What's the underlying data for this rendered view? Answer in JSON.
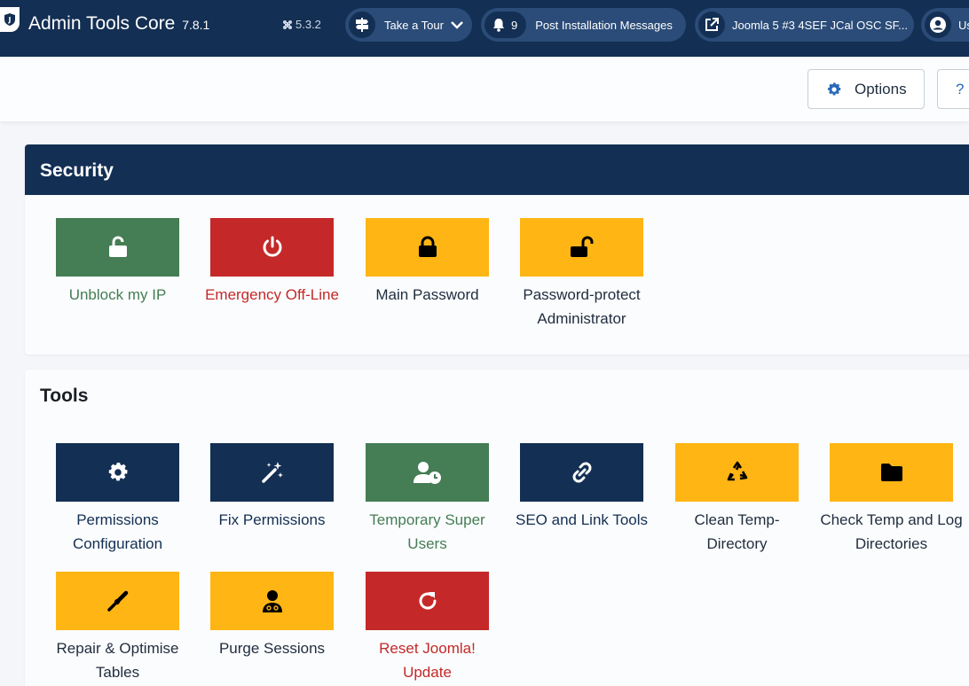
{
  "header": {
    "app_title": "Admin Tools Core",
    "app_version": "7.8.1",
    "joomla_version": "5.3.2",
    "tour_label": "Take a Tour",
    "messages_count": "9",
    "messages_label": "Post Installation Messages",
    "site_label": "Joomla 5 #3 4SEF JCal OSC SF...",
    "user_label": "User Menu"
  },
  "toolbar": {
    "options_label": "Options",
    "help_label": "?"
  },
  "sections": {
    "security": {
      "title": "Security",
      "items": [
        {
          "label": "Unblock my IP",
          "icon": "unlock-icon",
          "color": "#457d54"
        },
        {
          "label": "Emergency Off-Line",
          "icon": "power-icon",
          "color": "#c52828"
        },
        {
          "label": "Main Password",
          "icon": "lock-icon",
          "color": "#ffb514"
        },
        {
          "label": "Password-protect Administrator",
          "icon": "lock-open-icon",
          "color": "#ffb514"
        }
      ]
    },
    "tools": {
      "title": "Tools",
      "items": [
        {
          "label": "Permissions Configuration",
          "icon": "gear-icon",
          "color": "#132f53"
        },
        {
          "label": "Fix Permissions",
          "icon": "magic-wand-icon",
          "color": "#132f53"
        },
        {
          "label": "Temporary Super Users",
          "icon": "user-clock-icon",
          "color": "#457d54"
        },
        {
          "label": "SEO and Link Tools",
          "icon": "link-icon",
          "color": "#132f53"
        },
        {
          "label": "Clean Temp-Directory",
          "icon": "recycle-icon",
          "color": "#ffb514"
        },
        {
          "label": "Check Temp and Log Directories",
          "icon": "folder-icon",
          "color": "#ffb514"
        },
        {
          "label": "Repair & Optimise Tables",
          "icon": "screwdriver-icon",
          "color": "#ffb514"
        },
        {
          "label": "Purge Sessions",
          "icon": "user-doctor-icon",
          "color": "#ffb514"
        },
        {
          "label": "Reset Joomla! Update",
          "icon": "refresh-icon",
          "color": "#c52828"
        }
      ]
    }
  }
}
